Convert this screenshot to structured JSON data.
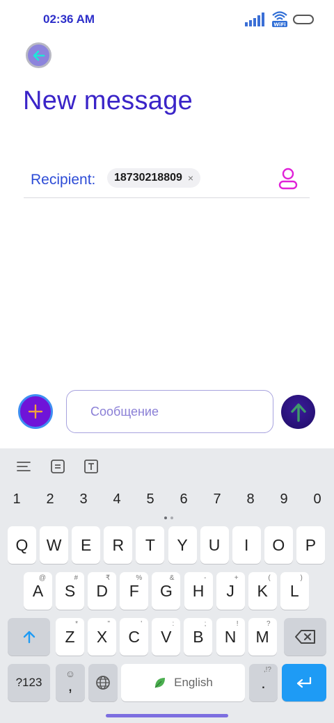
{
  "status_bar": {
    "time": "02:36 AM",
    "icons": [
      "signal-icon",
      "wifi-icon",
      "battery-icon"
    ],
    "wifi_label": "WiFi"
  },
  "header": {
    "back_icon": "arrow-left-icon",
    "title": "New message"
  },
  "recipient": {
    "label": "Recipient:",
    "chip_value": "18730218809",
    "chip_close": "×",
    "contact_icon": "person-icon"
  },
  "compose": {
    "attach_icon": "plus-icon",
    "placeholder": "Сообщение",
    "send_icon": "arrow-up-icon"
  },
  "keyboard": {
    "toolbar_icons": [
      "align-left-icon",
      "clipboard-icon",
      "text-box-icon"
    ],
    "number_row": [
      "1",
      "2",
      "3",
      "4",
      "5",
      "6",
      "7",
      "8",
      "9",
      "0"
    ],
    "row1": [
      {
        "k": "Q",
        "s": ""
      },
      {
        "k": "W",
        "s": ""
      },
      {
        "k": "E",
        "s": ""
      },
      {
        "k": "R",
        "s": ""
      },
      {
        "k": "T",
        "s": ""
      },
      {
        "k": "Y",
        "s": ""
      },
      {
        "k": "U",
        "s": ""
      },
      {
        "k": "I",
        "s": ""
      },
      {
        "k": "O",
        "s": ""
      },
      {
        "k": "P",
        "s": ""
      }
    ],
    "row2": [
      {
        "k": "A",
        "s": "@"
      },
      {
        "k": "S",
        "s": "#"
      },
      {
        "k": "D",
        "s": "₹"
      },
      {
        "k": "F",
        "s": "%"
      },
      {
        "k": "G",
        "s": "&"
      },
      {
        "k": "H",
        "s": "-"
      },
      {
        "k": "J",
        "s": "+"
      },
      {
        "k": "K",
        "s": "("
      },
      {
        "k": "L",
        "s": ")"
      }
    ],
    "row3": [
      {
        "k": "Z",
        "s": "*"
      },
      {
        "k": "X",
        "s": "\""
      },
      {
        "k": "C",
        "s": "'"
      },
      {
        "k": "V",
        "s": ":"
      },
      {
        "k": "B",
        "s": ";"
      },
      {
        "k": "N",
        "s": "!"
      },
      {
        "k": "M",
        "s": "?"
      }
    ],
    "shift_icon": "arrow-up-icon",
    "backspace_icon": "backspace-icon",
    "symbols_label": "?123",
    "emoji_comma": ",",
    "globe_icon": "globe-icon",
    "space_label": "English",
    "leaf_icon": "leaf-icon",
    "period_label": ".",
    "period_sub": ",!?",
    "enter_icon": "enter-icon"
  },
  "colors": {
    "accent": "#3a24c8",
    "recipient_label": "#2d4cd6",
    "contact_icon": "#e020d8",
    "enter_key": "#1e9bf5"
  }
}
